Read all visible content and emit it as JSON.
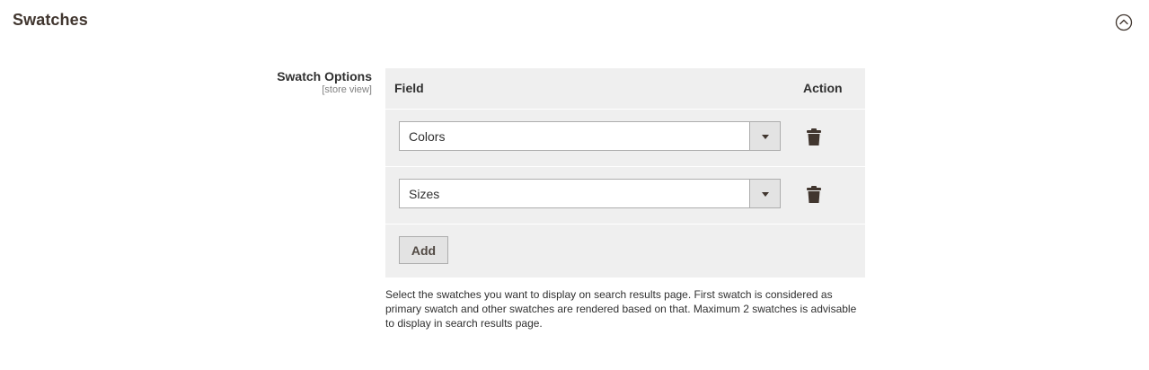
{
  "section": {
    "title": "Swatches",
    "toggle_icon": "chevron-up-circle-icon"
  },
  "field": {
    "label": "Swatch Options",
    "scope": "[store view]"
  },
  "table": {
    "headers": {
      "field": "Field",
      "action": "Action"
    },
    "rows": [
      {
        "value": "Colors",
        "action_icon": "trash-icon"
      },
      {
        "value": "Sizes",
        "action_icon": "trash-icon"
      }
    ],
    "add_label": "Add"
  },
  "note": "Select the swatches you want to display on search results page. First swatch is considered as primary swatch and other swatches are rendered based on that. Maximum 2 swatches is advisable to display in search results page.",
  "colors": {
    "table_bg": "#efefef",
    "select_arrow_bg": "#e3e3e3",
    "button_bg": "#e3e3e3",
    "icon": "#41362f",
    "text": "#303030"
  }
}
